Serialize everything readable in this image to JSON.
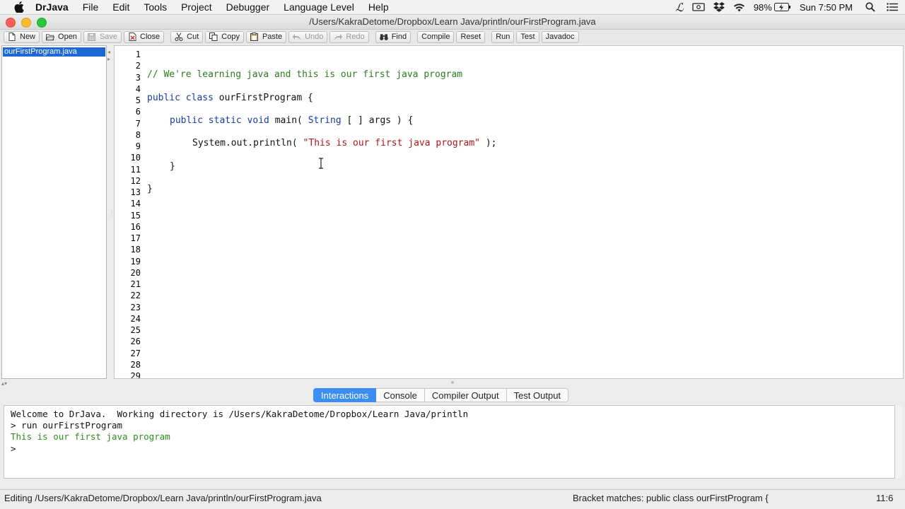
{
  "menubar": {
    "app": "DrJava",
    "items": [
      "File",
      "Edit",
      "Tools",
      "Project",
      "Debugger",
      "Language Level",
      "Help"
    ],
    "battery": "98%",
    "clock": "Sun 7:50 PM"
  },
  "window": {
    "title": "/Users/KakraDetome/Dropbox/Learn Java/println/ourFirstProgram.java"
  },
  "toolbar": {
    "new": "New",
    "open": "Open",
    "save": "Save",
    "close": "Close",
    "cut": "Cut",
    "copy": "Copy",
    "paste": "Paste",
    "undo": "Undo",
    "redo": "Redo",
    "find": "Find",
    "compile": "Compile",
    "reset": "Reset",
    "run": "Run",
    "test": "Test",
    "javadoc": "Javadoc"
  },
  "files": [
    "ourFirstProgram.java"
  ],
  "editor": {
    "line_count": 29,
    "comment": "// We're learning java and this is our first java program",
    "l5_kw": "public class",
    "l5_rest": " ourFirstProgram {",
    "l7_kw": "public static void",
    "l7_mid": " main( ",
    "l7_type": "String",
    "l7_rest": " [ ] args ) {",
    "l9_pre": "System.out.println( ",
    "l9_str": "\"This is our first java program\"",
    "l9_post": " );",
    "l11": "}",
    "l13": "}"
  },
  "tabs": [
    "Interactions",
    "Console",
    "Compiler Output",
    "Test Output"
  ],
  "interactions": {
    "lines": [
      "Welcome to DrJava.  Working directory is /Users/KakraDetome/Dropbox/Learn Java/println",
      "> run ourFirstProgram",
      "This is our first java program",
      ">"
    ]
  },
  "status": {
    "editing": "Editing /Users/KakraDetome/Dropbox/Learn Java/println/ourFirstProgram.java",
    "bracket": "Bracket matches: public class ourFirstProgram {",
    "position": "11:6"
  }
}
